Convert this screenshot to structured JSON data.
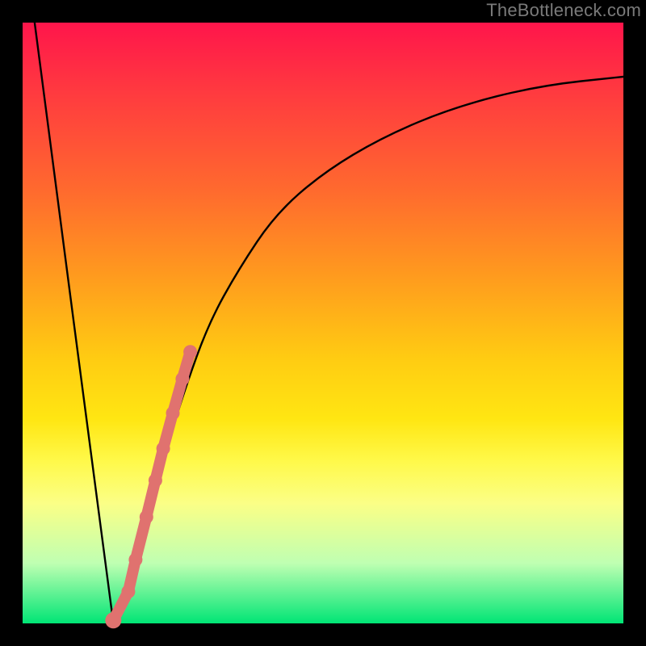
{
  "watermark": {
    "text": "TheBottleneck.com"
  },
  "colors": {
    "curve": "#000000",
    "marker": "#e0726f",
    "frame": "#000000"
  },
  "chart_data": {
    "type": "line",
    "title": "",
    "xlabel": "",
    "ylabel": "",
    "xlim": [
      0,
      100
    ],
    "ylim": [
      0,
      100
    ],
    "series": [
      {
        "name": "bottleneck-curve",
        "x": [
          2,
          14.8,
          15.1,
          17.2,
          20,
          23,
          27,
          31,
          36,
          42,
          50,
          60,
          72,
          86,
          100
        ],
        "y": [
          100,
          2,
          0.5,
          4,
          15,
          26,
          39,
          50,
          59,
          68,
          75,
          81,
          86,
          89.5,
          91
        ]
      }
    ],
    "markers": [
      {
        "name": "highlight-segment",
        "x": [
          15.1,
          17.6,
          18.8,
          20.6,
          22.1,
          23.4,
          25.0,
          26.6,
          27.9
        ],
        "y": [
          0.5,
          5.3,
          10.6,
          17.7,
          23.8,
          29.1,
          35.0,
          40.7,
          45.2
        ]
      }
    ]
  }
}
